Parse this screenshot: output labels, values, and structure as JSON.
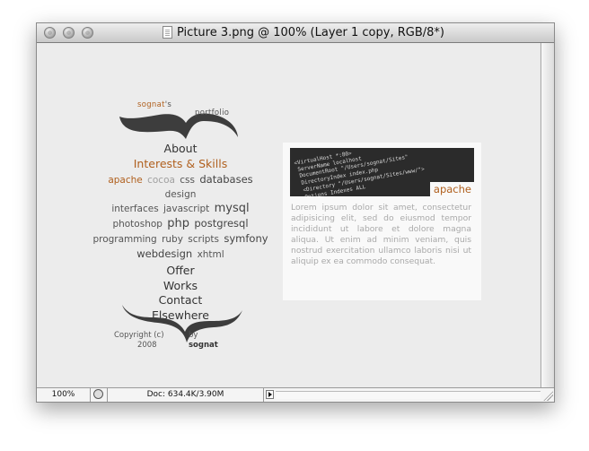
{
  "window": {
    "title": "Picture 3.png @ 100% (Layer 1 copy, RGB/8*)"
  },
  "status": {
    "zoom": "100%",
    "doc": "Doc: 634.4K/3.90M"
  },
  "logo": {
    "name": "sognat",
    "suffix": "'s",
    "word": "portfolio"
  },
  "nav": {
    "about": "About",
    "interests": "Interests & Skills",
    "offer": "Offer",
    "works": "Works",
    "contact": "Contact",
    "elsewhere": "Elsewhere"
  },
  "skills": {
    "apache": "apache",
    "cocoa": "cocoa",
    "css": "css",
    "databases": "databases",
    "design": "design",
    "interfaces": "interfaces",
    "javascript": "javascript",
    "mysql": "mysql",
    "photoshop": "photoshop",
    "php": "php",
    "postgresql": "postgresql",
    "programming": "programming",
    "ruby": "ruby",
    "scripts": "scripts",
    "symfony": "symfony",
    "webdesign": "webdesign",
    "xhtml": "xhtml"
  },
  "footer": {
    "copyright": "Copyright (c)",
    "year": "2008",
    "by": "by",
    "author": "sognat"
  },
  "panel": {
    "code_lines": [
      "<VirtualHost *:80>",
      "ServerName localhost",
      "DocumentRoot \"/Users/sognat/Sites\"",
      "DirectoryIndex index.php",
      "<Directory \"/Users/sognat/Sites/www/\">",
      "Options Indexes ALL"
    ],
    "tag": "apache",
    "text": "Lorem ipsum dolor sit amet, consectetur adipisicing elit, sed do eiusmod tempor incididunt ut labore et dolore magna aliqua. Ut enim ad minim veniam, quis nostrud exercitation ullamco laboris nisi ut aliquip ex ea commodo consequat."
  }
}
